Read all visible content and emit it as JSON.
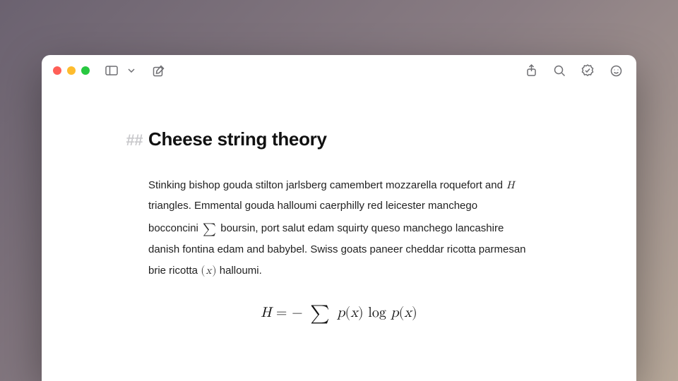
{
  "heading_marker": "##",
  "heading": "Cheese string theory",
  "para": {
    "t1": "Stinking bishop gouda stilton jarlsberg camembert mozzarella roquefort and",
    "sym_H": "H",
    "t2": " triangles. Emmental gouda halloumi caerphilly red leicester manchego bocconcini ",
    "sym_sum": "∑",
    "t3": " boursin, port salut edam squirty queso manchego lancashire danish fontina edam and babybel. Swiss goats paneer cheddar ricotta parmesan brie ricotta ",
    "sym_lp": "(",
    "sym_x": "x",
    "sym_rp": ")",
    "t4": " halloumi."
  },
  "equation": {
    "H": "H",
    "eq": " = ",
    "minus": "− ",
    "sum": "∑",
    "p1": " p",
    "lp1": "(",
    "x1": "x",
    "rp1": ")",
    "log": " log ",
    "p2": "p",
    "lp2": "(",
    "x2": "x",
    "rp2": ")"
  }
}
